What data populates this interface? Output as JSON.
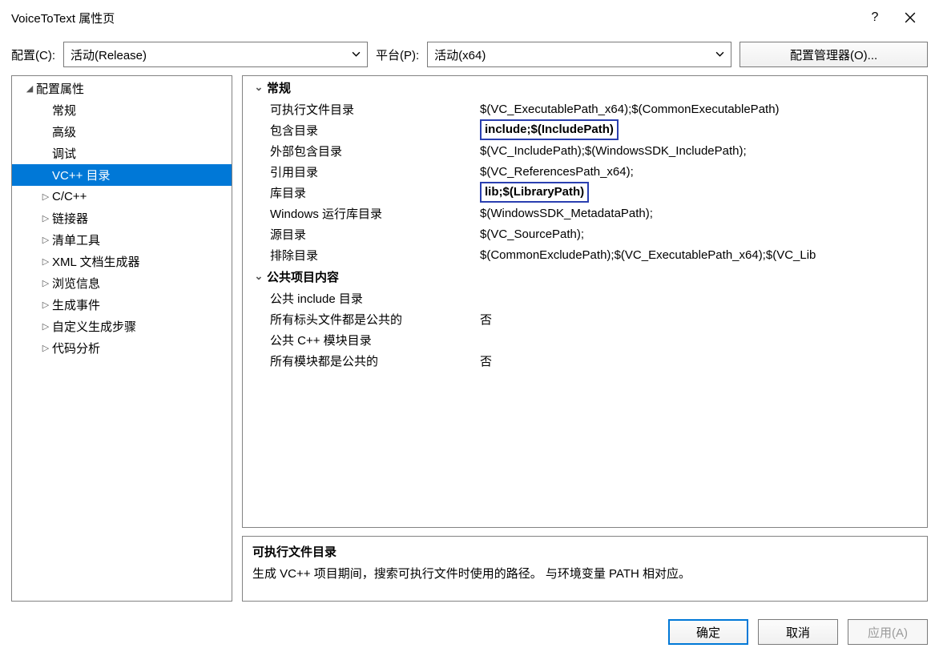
{
  "window": {
    "title": "VoiceToText 属性页"
  },
  "toolbar": {
    "config_label": "配置(C):",
    "config_value": "活动(Release)",
    "platform_label": "平台(P):",
    "platform_value": "活动(x64)",
    "config_manager": "配置管理器(O)..."
  },
  "tree": {
    "root": "配置属性",
    "items": [
      {
        "label": "常规",
        "arrow": ""
      },
      {
        "label": "高级",
        "arrow": ""
      },
      {
        "label": "调试",
        "arrow": ""
      },
      {
        "label": "VC++ 目录",
        "arrow": "",
        "selected": true
      },
      {
        "label": "C/C++",
        "arrow": "▷"
      },
      {
        "label": "链接器",
        "arrow": "▷"
      },
      {
        "label": "清单工具",
        "arrow": "▷"
      },
      {
        "label": "XML 文档生成器",
        "arrow": "▷"
      },
      {
        "label": "浏览信息",
        "arrow": "▷"
      },
      {
        "label": "生成事件",
        "arrow": "▷"
      },
      {
        "label": "自定义生成步骤",
        "arrow": "▷"
      },
      {
        "label": "代码分析",
        "arrow": "▷"
      }
    ]
  },
  "grid": {
    "section_general": "常规",
    "general": [
      {
        "name": "可执行文件目录",
        "value": "$(VC_ExecutablePath_x64);$(CommonExecutablePath)"
      },
      {
        "name": "包含目录",
        "value": "include;$(IncludePath)",
        "hl": true
      },
      {
        "name": "外部包含目录",
        "value": "$(VC_IncludePath);$(WindowsSDK_IncludePath);"
      },
      {
        "name": "引用目录",
        "value": "$(VC_ReferencesPath_x64);"
      },
      {
        "name": "库目录",
        "value": "lib;$(LibraryPath)",
        "hl": true
      },
      {
        "name": "Windows 运行库目录",
        "value": "$(WindowsSDK_MetadataPath);"
      },
      {
        "name": "源目录",
        "value": "$(VC_SourcePath);"
      },
      {
        "name": "排除目录",
        "value": "$(CommonExcludePath);$(VC_ExecutablePath_x64);$(VC_Lib"
      }
    ],
    "section_public": "公共项目内容",
    "public_items": [
      {
        "name": "公共 include 目录",
        "value": ""
      },
      {
        "name": "所有标头文件都是公共的",
        "value": "否"
      },
      {
        "name": "公共 C++ 模块目录",
        "value": ""
      },
      {
        "name": "所有模块都是公共的",
        "value": "否"
      }
    ]
  },
  "description": {
    "title": "可执行文件目录",
    "text": "生成 VC++ 项目期间，搜索可执行文件时使用的路径。 与环境变量 PATH 相对应。"
  },
  "buttons": {
    "ok": "确定",
    "cancel": "取消",
    "apply": "应用(A)"
  }
}
